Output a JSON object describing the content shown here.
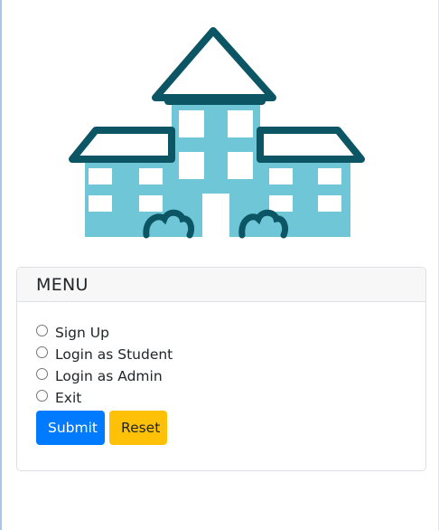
{
  "hero": {
    "icon": "school-building-icon",
    "colors": {
      "outline": "#0b5565",
      "fill": "#6ec6d6",
      "window": "#ffffff"
    }
  },
  "menu": {
    "title": "MENU",
    "options": [
      {
        "label": "Sign Up",
        "checked": false
      },
      {
        "label": "Login as Student",
        "checked": false
      },
      {
        "label": "Login as Admin",
        "checked": false
      },
      {
        "label": "Exit",
        "checked": false
      }
    ],
    "buttons": {
      "submit_label": "Submit",
      "reset_label": "Reset",
      "submit_color": "#007bff",
      "reset_color": "#ffc107"
    }
  }
}
